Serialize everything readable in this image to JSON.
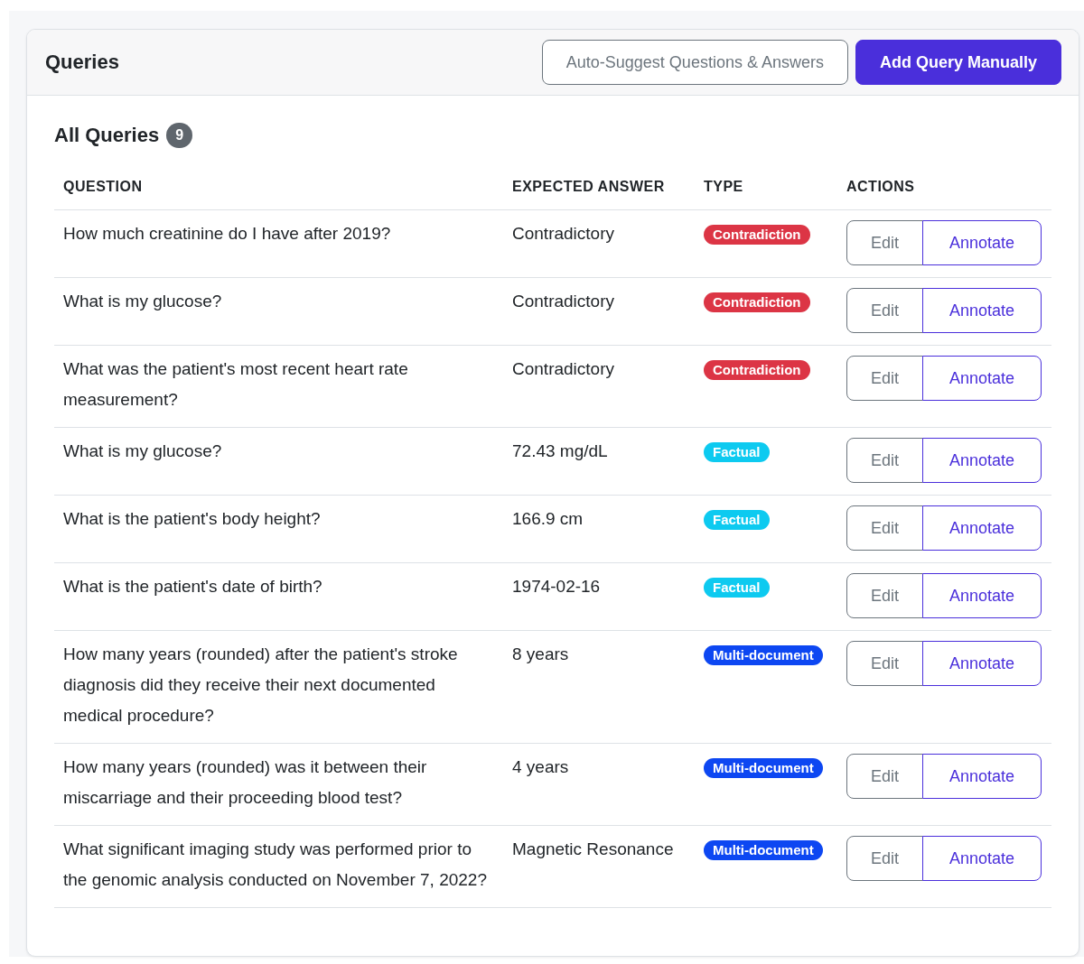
{
  "header": {
    "title": "Queries",
    "buttons": [
      {
        "label": "Auto-Suggest Questions & Answers",
        "kind": "outline"
      },
      {
        "label": "Add Query Manually",
        "kind": "primary"
      }
    ]
  },
  "section": {
    "title": "All Queries",
    "count": "9"
  },
  "table": {
    "columns": [
      "QUESTION",
      "EXPECTED ANSWER",
      "TYPE",
      "ACTIONS"
    ],
    "rows": [
      {
        "question": "How much creatinine do I have after 2019?",
        "answer": "Contradictory",
        "tag": {
          "label": "Contradiction",
          "color": "#dc3545"
        },
        "actions": [
          "Edit",
          "Annotate"
        ]
      },
      {
        "question": "What is my glucose?",
        "answer": "Contradictory",
        "tag": {
          "label": "Contradiction",
          "color": "#dc3545"
        },
        "actions": [
          "Edit",
          "Annotate"
        ]
      },
      {
        "question": "What was the patient's most recent heart rate measurement?",
        "answer": "Contradictory",
        "tag": {
          "label": "Contradiction",
          "color": "#dc3545"
        },
        "actions": [
          "Edit",
          "Annotate"
        ]
      },
      {
        "question": "What is my glucose?",
        "answer": "72.43 mg/dL",
        "tag": {
          "label": "Factual",
          "color": "#0dcaf0"
        },
        "actions": [
          "Edit",
          "Annotate"
        ]
      },
      {
        "question": "What is the patient's body height?",
        "answer": "166.9 cm",
        "tag": {
          "label": "Factual",
          "color": "#0dcaf0"
        },
        "actions": [
          "Edit",
          "Annotate"
        ]
      },
      {
        "question": "What is the patient's date of birth?",
        "answer": "1974-02-16",
        "tag": {
          "label": "Factual",
          "color": "#0dcaf0"
        },
        "actions": [
          "Edit",
          "Annotate"
        ]
      },
      {
        "question": "How many years (rounded) after the patient's stroke diagnosis did they receive their next documented medical procedure?",
        "answer": "8 years",
        "tag": {
          "label": "Multi-document",
          "color": "#0d47f2"
        },
        "actions": [
          "Edit",
          "Annotate"
        ]
      },
      {
        "question": "How many years (rounded) was it between their miscarriage and their proceeding blood test?",
        "answer": "4 years",
        "tag": {
          "label": "Multi-document",
          "color": "#0d47f2"
        },
        "actions": [
          "Edit",
          "Annotate"
        ]
      },
      {
        "question": "What significant imaging study was performed prior to the genomic analysis conducted on November 7, 2022?",
        "answer": "Magnetic Resonance",
        "tag": {
          "label": "Multi-document",
          "color": "#0d47f2"
        },
        "actions": [
          "Edit",
          "Annotate"
        ]
      }
    ]
  }
}
